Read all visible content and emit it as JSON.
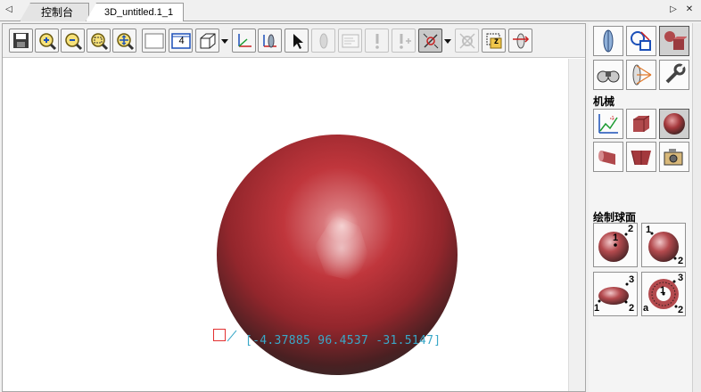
{
  "tabs": {
    "left_arrow": "◁",
    "items": [
      {
        "label": "控制台"
      },
      {
        "label": "3D_untitled.1_1"
      }
    ],
    "right_arrow": "▷",
    "close": "✕"
  },
  "toolbar": {
    "buttons": [
      {
        "name": "save-icon"
      },
      {
        "name": "zoom-in-icon"
      },
      {
        "name": "zoom-out-icon"
      },
      {
        "name": "zoom-window-icon"
      },
      {
        "name": "zoom-all-icon"
      },
      {
        "name": "blank-view-icon"
      },
      {
        "name": "viewport-count-icon",
        "text": "4"
      },
      {
        "name": "box-view-icon"
      },
      {
        "name": "axes-icon"
      },
      {
        "name": "plane-icon"
      },
      {
        "name": "select-arrow-icon"
      },
      {
        "name": "ghost-icon"
      },
      {
        "name": "panel-icon"
      },
      {
        "name": "exclamation-icon"
      },
      {
        "name": "exclamation-plus-icon"
      },
      {
        "name": "snap-pick-icon"
      },
      {
        "name": "gear-disabled-icon"
      },
      {
        "name": "z-coordinate-icon",
        "text": "z"
      },
      {
        "name": "sweep-icon"
      }
    ]
  },
  "viewport": {
    "coordinate_readout": "[-4.37885 96.4537 -31.5147]",
    "sphere_color": "#c0363c"
  },
  "right_panel": {
    "top_tools": [
      {
        "name": "lens-icon"
      },
      {
        "name": "shape-transform-icon"
      },
      {
        "name": "solids-icon"
      },
      {
        "name": "binoculars-icon"
      },
      {
        "name": "projection-icon"
      },
      {
        "name": "wrench-icon"
      }
    ],
    "mechanical_label": "机械",
    "mechanical_tools": [
      {
        "name": "axis-chart-icon"
      },
      {
        "name": "cube-icon"
      },
      {
        "name": "sphere-icon"
      },
      {
        "name": "cylinder-icon"
      },
      {
        "name": "wedge-icon"
      },
      {
        "name": "camera-icon"
      }
    ],
    "draw_sphere_label": "绘制球面",
    "sphere_modes": [
      {
        "name": "sphere-center-radius-icon",
        "labels": [
          "1",
          "2"
        ]
      },
      {
        "name": "sphere-two-point-icon",
        "labels": [
          "1",
          "2"
        ]
      },
      {
        "name": "ellipsoid-icon",
        "labels": [
          "1",
          "2",
          "3"
        ]
      },
      {
        "name": "torus-icon",
        "labels": [
          "1",
          "2",
          "3",
          "a"
        ]
      }
    ]
  },
  "colors": {
    "accent_cyan": "#3aa8c8",
    "cursor_red": "#e23030"
  }
}
